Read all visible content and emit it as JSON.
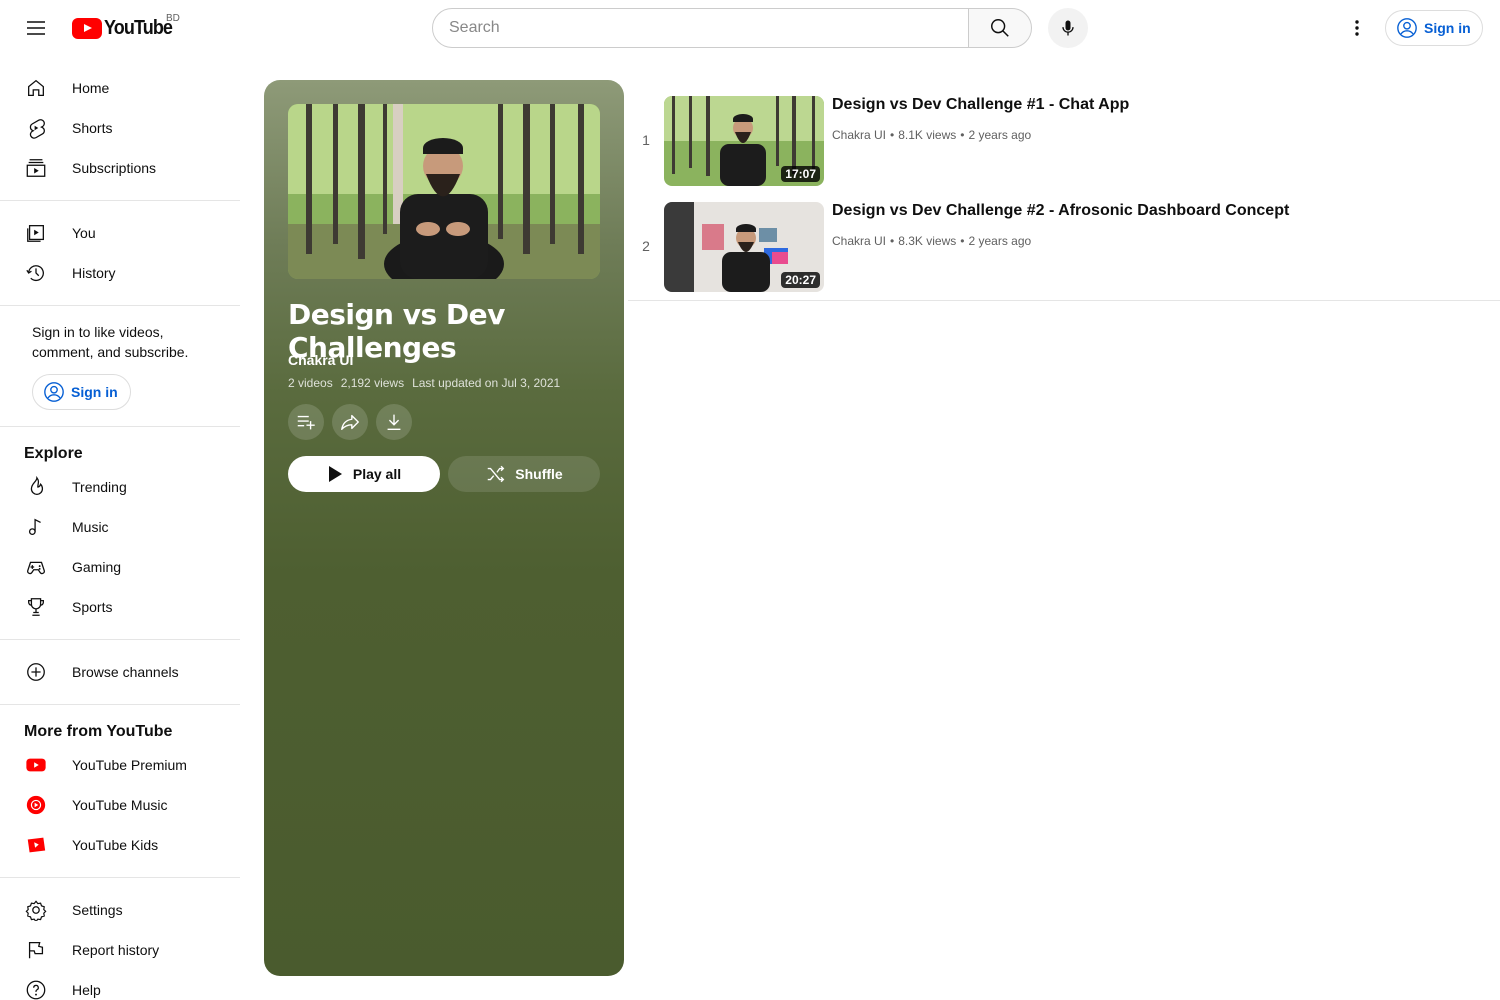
{
  "header": {
    "logo_text": "YouTube",
    "country_code": "BD",
    "search_placeholder": "Search",
    "sign_in_label": "Sign in"
  },
  "sidebar": {
    "main": [
      {
        "label": "Home",
        "icon": "home-icon"
      },
      {
        "label": "Shorts",
        "icon": "shorts-icon"
      },
      {
        "label": "Subscriptions",
        "icon": "subscriptions-icon"
      }
    ],
    "you": [
      {
        "label": "You",
        "icon": "you-icon"
      },
      {
        "label": "History",
        "icon": "history-icon"
      }
    ],
    "signin_prompt": "Sign in to like videos, comment, and subscribe.",
    "signin_label": "Sign in",
    "explore_title": "Explore",
    "explore": [
      {
        "label": "Trending",
        "icon": "trending-icon"
      },
      {
        "label": "Music",
        "icon": "music-icon"
      },
      {
        "label": "Gaming",
        "icon": "gaming-icon"
      },
      {
        "label": "Sports",
        "icon": "sports-icon"
      }
    ],
    "browse_channels": "Browse channels",
    "more_title": "More from YouTube",
    "more": [
      {
        "label": "YouTube Premium",
        "icon": "youtube-premium-icon"
      },
      {
        "label": "YouTube Music",
        "icon": "youtube-music-icon"
      },
      {
        "label": "YouTube Kids",
        "icon": "youtube-kids-icon"
      }
    ],
    "footer": [
      {
        "label": "Settings",
        "icon": "settings-icon"
      },
      {
        "label": "Report history",
        "icon": "flag-icon"
      },
      {
        "label": "Help",
        "icon": "help-icon"
      }
    ]
  },
  "playlist": {
    "title": "Design vs Dev Challenges",
    "owner": "Chakra UI",
    "video_count": "2 videos",
    "views": "2,192 views",
    "updated": "Last updated on Jul 3, 2021",
    "play_all_label": "Play all",
    "shuffle_label": "Shuffle"
  },
  "videos": [
    {
      "index": "1",
      "title": "Design vs Dev Challenge #1 - Chat App",
      "channel": "Chakra UI",
      "views": "8.1K views",
      "age": "2 years ago",
      "duration": "17:07"
    },
    {
      "index": "2",
      "title": "Design vs Dev Challenge #2 - Afrosonic Dashboard Concept",
      "channel": "Chakra UI",
      "views": "8.3K views",
      "age": "2 years ago",
      "duration": "20:27"
    }
  ],
  "colors": {
    "brand_red": "#ff0000",
    "link_blue": "#065fd4",
    "panel_green": "#4a5b2e"
  }
}
